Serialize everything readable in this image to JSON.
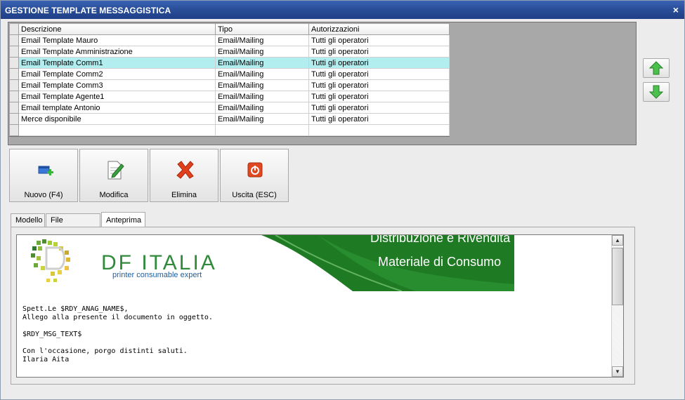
{
  "window": {
    "title": "GESTIONE TEMPLATE MESSAGGISTICA",
    "close_glyph": "×"
  },
  "grid": {
    "columns": [
      "Descrizione",
      "Tipo",
      "Autorizzazioni"
    ],
    "rows": [
      {
        "descrizione": "Email Template Mauro",
        "tipo": "Email/Mailing",
        "autorizzazioni": "Tutti gli operatori"
      },
      {
        "descrizione": "Email Template Amministrazione",
        "tipo": "Email/Mailing",
        "autorizzazioni": "Tutti gli operatori"
      },
      {
        "descrizione": "Email Template Comm1",
        "tipo": "Email/Mailing",
        "autorizzazioni": "Tutti gli operatori",
        "selected": true
      },
      {
        "descrizione": "Email Template Comm2",
        "tipo": "Email/Mailing",
        "autorizzazioni": "Tutti gli operatori"
      },
      {
        "descrizione": "Email Template Comm3",
        "tipo": "Email/Mailing",
        "autorizzazioni": "Tutti gli operatori"
      },
      {
        "descrizione": "Email Template Agente1",
        "tipo": "Email/Mailing",
        "autorizzazioni": "Tutti gli operatori"
      },
      {
        "descrizione": "Email template Antonio",
        "tipo": "Email/Mailing",
        "autorizzazioni": "Tutti gli operatori"
      },
      {
        "descrizione": "Merce disponibile",
        "tipo": "Email/Mailing",
        "autorizzazioni": "Tutti gli operatori"
      }
    ],
    "selected_color": "#b2eef0"
  },
  "toolbar": {
    "nuovo_label": "Nuovo (F4)",
    "modifica_label": "Modifica",
    "elimina_label": "Elimina",
    "uscita_label": "Uscita (ESC)"
  },
  "tabs": {
    "modello": "Modello",
    "file_aggiuntivi": "File aggiuntivi",
    "anteprima": "Anteprima",
    "active": "anteprima"
  },
  "preview": {
    "banner_line1": "Distribuzione e Rivendita",
    "banner_line2": "Materiale di Consumo",
    "logo_text": "DF ITALIA",
    "logo_tagline": "printer consumable expert",
    "body_lines": [
      "Spett.Le $RDY_ANAG_NAME$,",
      "Allego alla presente il documento in oggetto.",
      "",
      "$RDY_MSG_TEXT$",
      "",
      "Con l'occasione, porgo distinti saluti.",
      "Ilaria Aita"
    ]
  },
  "icons": {
    "move_up": "arrow-up-icon",
    "move_down": "arrow-down-icon",
    "nuovo": "new-window-icon",
    "modifica": "edit-document-icon",
    "elimina": "red-x-icon",
    "uscita": "power-icon"
  },
  "colors": {
    "titlebar": "#2a4f9a",
    "banner_green": "#1f7a24",
    "logo_green": "#2f8a3a"
  }
}
